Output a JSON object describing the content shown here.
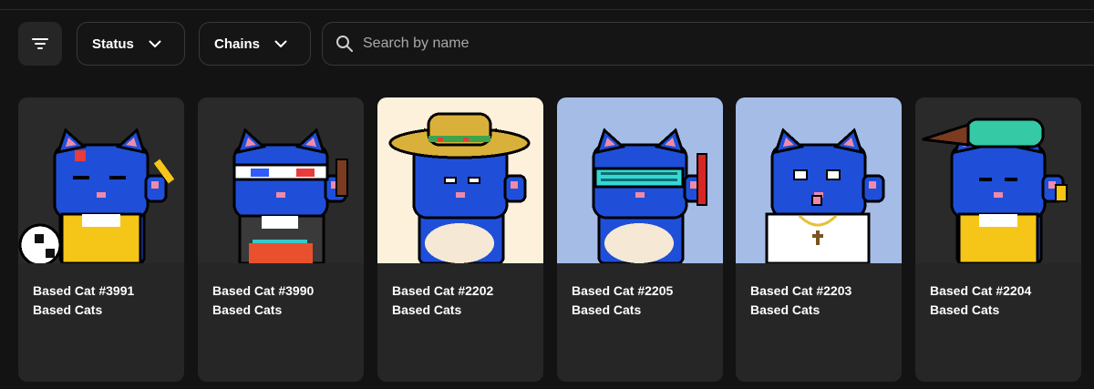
{
  "toolbar": {
    "status_label": "Status",
    "chains_label": "Chains",
    "search_placeholder": "Search by name",
    "search_value": ""
  },
  "colors": {
    "page_bg": "#131313",
    "card_bg": "#262626",
    "cat_blue": "#1f4fd9",
    "border": "#383838"
  },
  "cards": [
    {
      "name": "Based Cat #3991",
      "collection": "Based Cats",
      "bg": "#2a2a2a",
      "accessory": "soccer ball and yellow top"
    },
    {
      "name": "Based Cat #3990",
      "collection": "Based Cats",
      "bg": "#2a2a2a",
      "accessory": "3D glasses"
    },
    {
      "name": "Based Cat #2202",
      "collection": "Based Cats",
      "bg": "#fdf1dc",
      "accessory": "straw hat"
    },
    {
      "name": "Based Cat #2205",
      "collection": "Based Cats",
      "bg": "#a5bde6",
      "accessory": "shutter shades"
    },
    {
      "name": "Based Cat #2203",
      "collection": "Based Cats",
      "bg": "#a5bde6",
      "accessory": "white shirt"
    },
    {
      "name": "Based Cat #2204",
      "collection": "Based Cats",
      "bg": "#2a2a2a",
      "accessory": "teal cap"
    }
  ]
}
